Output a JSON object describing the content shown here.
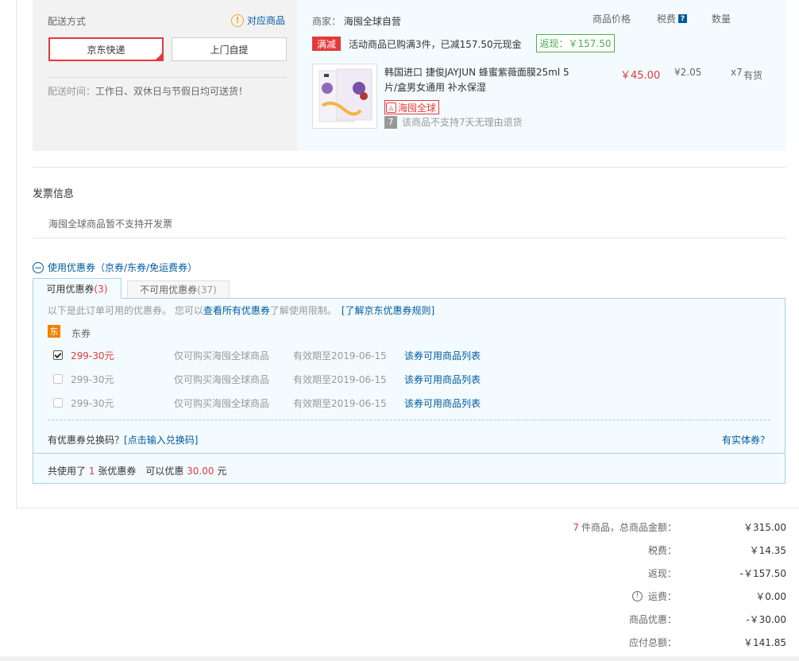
{
  "shipping": {
    "label": "配送方式",
    "match_icon": "warning-icon",
    "match_link": "对应商品",
    "options": [
      "京东快递",
      "上门自提"
    ],
    "time_label": "配送时间：",
    "time_value": "工作日、双休日与节假日均可送货！"
  },
  "merchant": {
    "label": "商家：",
    "name": "海囤全球自营",
    "columns": {
      "price": "商品价格",
      "tax": "税费",
      "qty": "数量"
    },
    "promo_tag": "满减",
    "promo_text": "活动商品已购满3件，已减157.50元现金",
    "cashback": "返现：￥157.50"
  },
  "product": {
    "title": "韩国进口 捷俊JAYJUN 蜂蜜紫薇面膜25ml 5片/盒男女通用 补水保湿",
    "origin_tag": "海囤全球",
    "return_badge": "7",
    "return_note": "该商品不支持7天无理由退货",
    "price": "￥45.00",
    "tax": "¥2.05",
    "qty": "x7",
    "stock": "有货"
  },
  "invoice": {
    "title": "发票信息",
    "text": "海囤全球商品暂不支持开发票"
  },
  "coupons": {
    "toggle_label": "使用优惠券（京券/东券/免运费券）",
    "tab_available": "可用优惠券",
    "tab_available_count": "(3)",
    "tab_unavailable": "不可用优惠券",
    "tab_unavailable_count": "(37)",
    "note_prefix": "以下是此订单可用的优惠券。 您可以",
    "note_link1": "查看所有优惠券",
    "note_mid": "了解使用限制。",
    "note_link2": "[了解京东优惠券规则]",
    "group_badge": "东",
    "group_label": "东券",
    "items": [
      {
        "checked": true,
        "amount": "299-30元",
        "scope": "仅可购买海囤全球商品",
        "valid": "有效期至2019-06-15",
        "link": "该券可用商品列表"
      },
      {
        "checked": false,
        "amount": "299-30元",
        "scope": "仅可购买海囤全球商品",
        "valid": "有效期至2019-06-15",
        "link": "该券可用商品列表"
      },
      {
        "checked": false,
        "amount": "299-30元",
        "scope": "仅可购买海囤全球商品",
        "valid": "有效期至2019-06-15",
        "link": "该券可用商品列表"
      }
    ],
    "redeem_prefix": "有优惠券兑换码？",
    "redeem_link": "[点击输入兑换码]",
    "physical_link": "有实体券？",
    "used_prefix": "共使用了",
    "used_count": "1",
    "used_mid": "张优惠券　可以优惠",
    "used_amount": "30.00",
    "used_suffix": "元"
  },
  "summary": {
    "count": "7",
    "count_label": "件商品，总商品金额：",
    "total": "￥315.00",
    "tax_label": "税费：",
    "tax": "￥14.35",
    "cashback_label": "返现：",
    "cashback": "-￥157.50",
    "freight_label": "运费：",
    "freight": "￥0.00",
    "discount_label": "商品优惠：",
    "discount": "-￥30.00",
    "payable_label": "应付总额：",
    "payable": "￥141.85"
  }
}
